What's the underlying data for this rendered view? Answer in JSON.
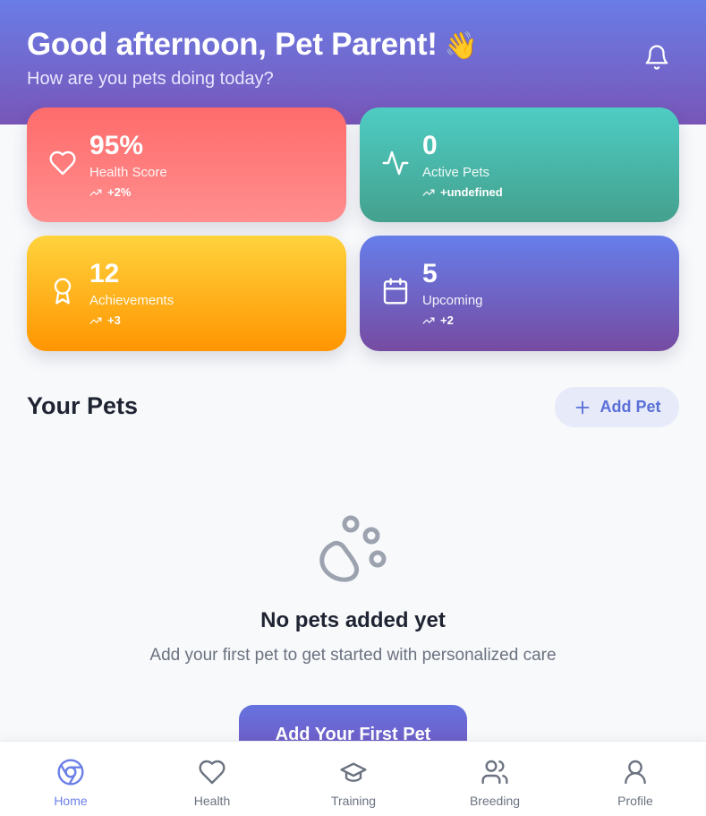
{
  "header": {
    "greeting": "Good afternoon, Pet Parent!",
    "wave_emoji": "👋",
    "subtitle": "How are you pets doing today?",
    "notification_icon": "bell-icon"
  },
  "stats": [
    {
      "value": "95%",
      "label": "Health Score",
      "trend": "+2%",
      "icon": "heart-icon",
      "color": "#ff6b6b"
    },
    {
      "value": "0",
      "label": "Active Pets",
      "trend": "+undefined",
      "icon": "activity-icon",
      "color": "#4ecdc4"
    },
    {
      "value": "12",
      "label": "Achievements",
      "trend": "+3",
      "icon": "award-icon",
      "color": "#ffb020"
    },
    {
      "value": "5",
      "label": "Upcoming",
      "trend": "+2",
      "icon": "calendar-icon",
      "color": "#6a6fd8"
    }
  ],
  "pets_section": {
    "title": "Your Pets",
    "add_label": "Add Pet"
  },
  "empty_state": {
    "icon": "paw-icon",
    "title": "No pets added yet",
    "subtitle": "Add your first pet to get started with personalized care",
    "cta_label": "Add Your First Pet"
  },
  "bottom_nav": [
    {
      "label": "Home",
      "icon": "home-icon",
      "active": true
    },
    {
      "label": "Health",
      "icon": "heart-icon",
      "active": false
    },
    {
      "label": "Training",
      "icon": "graduation-cap-icon",
      "active": false
    },
    {
      "label": "Breeding",
      "icon": "users-icon",
      "active": false
    },
    {
      "label": "Profile",
      "icon": "user-icon",
      "active": false
    }
  ],
  "colors": {
    "header_start": "#6a7de6",
    "header_end": "#7856b8",
    "accent": "#6b7fe6",
    "muted": "#6b7280"
  }
}
